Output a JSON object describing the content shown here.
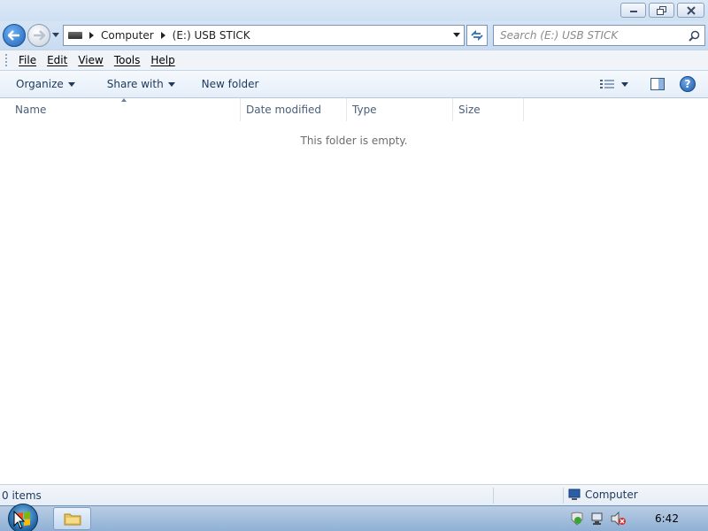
{
  "window": {
    "minimize_icon": "minimize-icon",
    "maximize_icon": "restore-icon",
    "close_icon": "close-icon"
  },
  "nav": {
    "back_icon": "back-arrow-icon",
    "forward_icon": "forward-arrow-icon",
    "breadcrumbs": [
      "Computer",
      "(E:) USB STICK"
    ],
    "search_placeholder": "Search (E:) USB STICK"
  },
  "menu": {
    "items": [
      {
        "label": "File"
      },
      {
        "label": "Edit"
      },
      {
        "label": "View"
      },
      {
        "label": "Tools"
      },
      {
        "label": "Help"
      }
    ]
  },
  "commands": {
    "organize": "Organize",
    "share_with": "Share with",
    "new_folder": "New folder",
    "help_label": "?"
  },
  "columns": {
    "name": "Name",
    "date_modified": "Date modified",
    "type": "Type",
    "size": "Size"
  },
  "content": {
    "empty_message": "This folder is empty."
  },
  "status": {
    "item_count": "0 items",
    "zone": "Computer"
  },
  "taskbar": {
    "clock": "6:42"
  },
  "colors": {
    "accent": "#1e395b",
    "titlebar": "#dbe8f6",
    "taskbar": "#a9c2e0"
  }
}
